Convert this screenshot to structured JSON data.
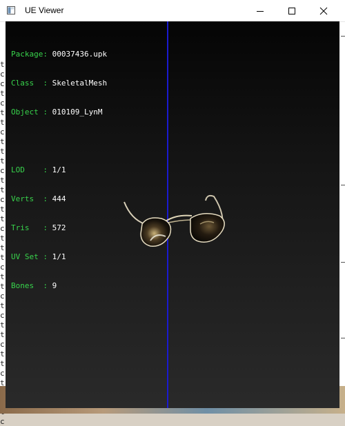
{
  "window": {
    "title": "UE Viewer"
  },
  "controls": {
    "minimize": "minimize",
    "maximize": "maximize",
    "close": "close"
  },
  "info": {
    "package_label": "Package",
    "package_value": "00037436.upk",
    "class_label": "Class  ",
    "class_value": "SkeletalMesh",
    "object_label": "Object ",
    "object_value": "010109_LynM",
    "lod_label": "LOD    ",
    "lod_value": "1/1",
    "verts_label": "Verts  ",
    "verts_value": "444",
    "tris_label": "Tris   ",
    "tris_value": "572",
    "uvset_label": "UV Set ",
    "uvset_value": "1/1",
    "bones_label": "Bones  ",
    "bones_value": "9"
  },
  "colors": {
    "label": "#38d44c",
    "value": "#ffffff",
    "axis": "#1a1ad0"
  },
  "background": {
    "left_edge_chars": [
      "t",
      "c",
      "c",
      "t",
      "c",
      "t",
      "t",
      "c",
      "t",
      "t",
      "t",
      "c",
      "t",
      "t",
      "c",
      "t",
      "t",
      "c",
      "t",
      "t",
      "t",
      "c",
      "t",
      "t",
      "c",
      "t",
      "c",
      "t",
      "t",
      "c",
      "t",
      "t",
      "c",
      "t",
      "t",
      "c",
      "t",
      "c"
    ]
  }
}
